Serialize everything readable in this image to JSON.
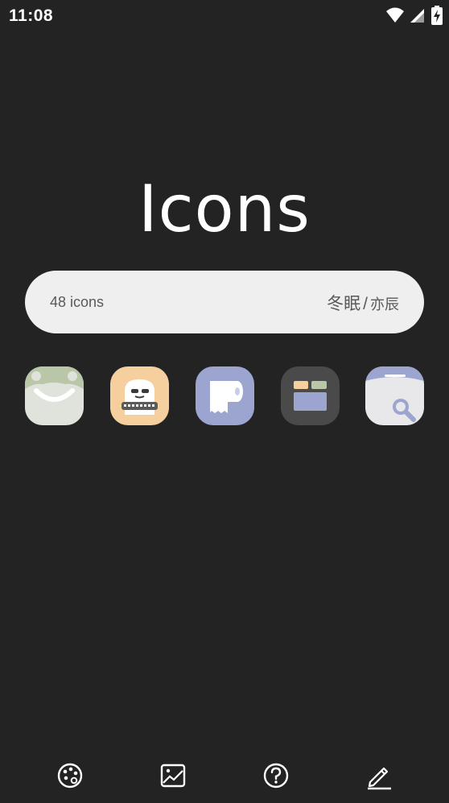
{
  "status_bar": {
    "time": "11:08",
    "icons": [
      "wifi-icon",
      "signal-icon",
      "battery-charging-icon"
    ]
  },
  "title": "Icons",
  "info": {
    "count_text": "48 icons",
    "author_main": "冬眠",
    "separator": "/",
    "author_sub": "亦辰"
  },
  "preview_icons": [
    {
      "name": "android-face-icon",
      "bg": "#dfe3dc"
    },
    {
      "name": "keyboard-face-icon",
      "bg": "#f6cf9e"
    },
    {
      "name": "toilet-paper-icon",
      "bg": "#9ca4d0"
    },
    {
      "name": "window-grid-icon",
      "bg": "#4a4a4a"
    },
    {
      "name": "storage-search-icon",
      "bg": "#e8e8ea"
    }
  ],
  "bottom_nav": [
    {
      "name": "palette-icon"
    },
    {
      "name": "wallpaper-icon"
    },
    {
      "name": "help-icon"
    },
    {
      "name": "edit-icon"
    }
  ]
}
